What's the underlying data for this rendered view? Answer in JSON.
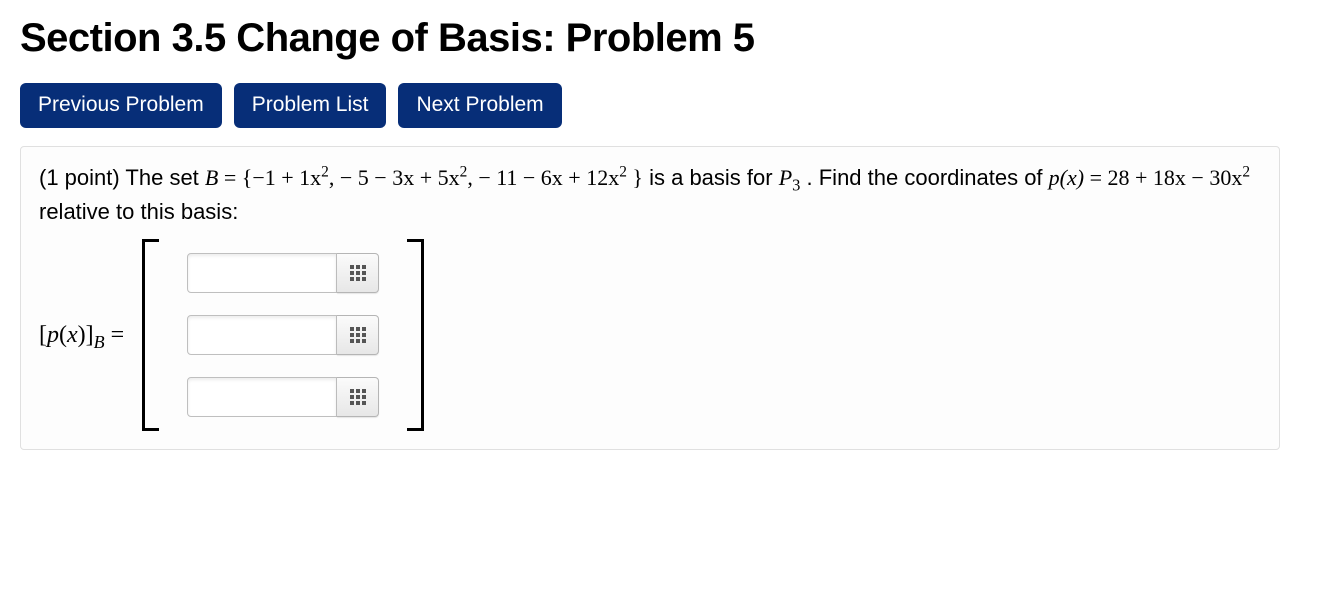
{
  "title": "Section 3.5 Change of Basis: Problem 5",
  "nav": {
    "prev": "Previous Problem",
    "list": "Problem List",
    "next": "Next Problem"
  },
  "problem": {
    "points_prefix": "(1 point) The set ",
    "basis_symbol": "B",
    "equals": " = ",
    "set_open": "{",
    "b1": "−1 + 1x",
    "b1_sup": "2",
    "sep1": ",   − 5 − 3x + 5x",
    "b2_sup": "2",
    "sep2": ",   − 11 − 6x + 12x",
    "b3_sup": "2",
    "set_close": " }",
    "tail1": " is a basis for ",
    "space": "P",
    "space_sub": "3",
    "tail2": " . Find the coordinates of ",
    "p_of_x": "p(x)",
    "eq2": " = 28 + 18x − 30x",
    "px_sup": "2",
    "tail3": "  relative to this basis:"
  },
  "lhs": {
    "open": "[",
    "p": "p",
    "paren_open": "(",
    "x": "x",
    "paren_close": ")",
    "close": "]",
    "sub": "B",
    "eq": " ="
  },
  "entries": [
    {
      "value": ""
    },
    {
      "value": ""
    },
    {
      "value": ""
    }
  ]
}
